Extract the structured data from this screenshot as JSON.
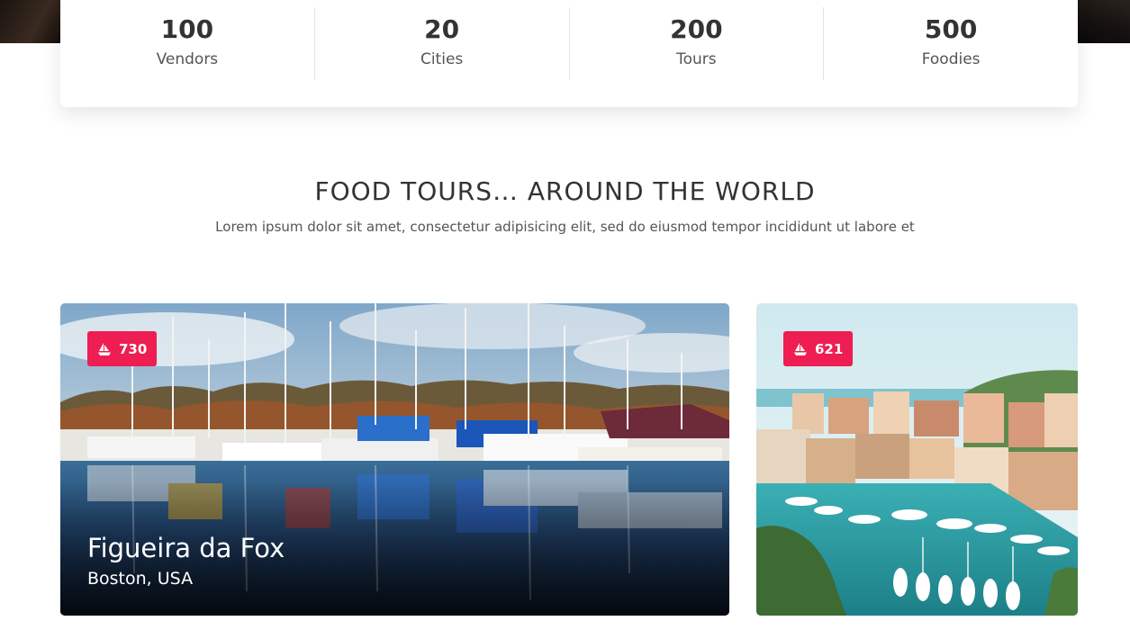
{
  "stats": [
    {
      "value": "100",
      "label": "Vendors"
    },
    {
      "value": "20",
      "label": "Cities"
    },
    {
      "value": "200",
      "label": "Tours"
    },
    {
      "value": "500",
      "label": "Foodies"
    }
  ],
  "section": {
    "title": "FOOD TOURS… AROUND THE WORLD",
    "subtitle": "Lorem ipsum dolor sit amet, consectetur adipisicing elit, sed do eiusmod tempor incididunt ut labore et"
  },
  "cards": [
    {
      "count": "730",
      "icon": "boat-icon",
      "name": "Figueira da Fox",
      "location": "Boston, USA"
    },
    {
      "count": "621",
      "icon": "boat-icon"
    }
  ],
  "colors": {
    "accent": "#ee1d52",
    "text": "#333333",
    "muted": "#555555"
  }
}
